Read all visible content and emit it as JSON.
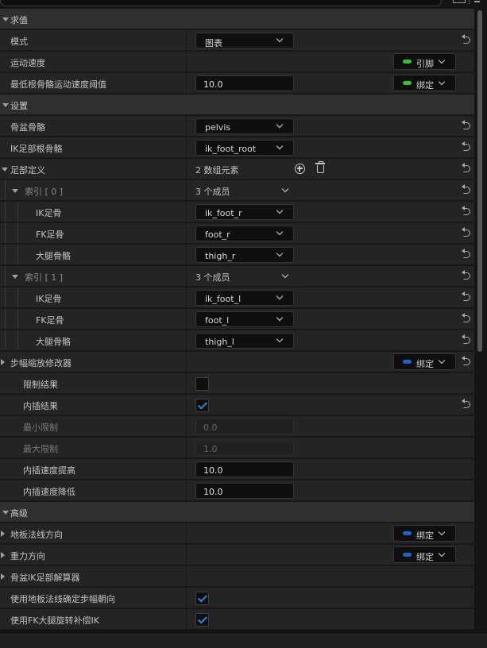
{
  "colors": {
    "link_green": "#35c22a",
    "bind_blue": "#1e64c8",
    "check_blue": "#2b8ae6"
  },
  "rows": [
    {
      "type": "section",
      "label": "求值"
    },
    {
      "type": "combo",
      "label": "模式",
      "value": "图表",
      "reset": true
    },
    {
      "type": "pill",
      "label": "运动速度",
      "pill": "引脚",
      "pill_color": "#35c22a",
      "reset": false
    },
    {
      "type": "num_pill",
      "label": "最低根骨骼运动速度阈值",
      "value": "10.0",
      "pill": "绑定",
      "pill_color": "#35c22a",
      "reset": false
    },
    {
      "type": "section",
      "label": "设置"
    },
    {
      "type": "combo",
      "label": "骨盆骨骼",
      "value": "pelvis",
      "reset": true
    },
    {
      "type": "combo",
      "label": "IK足部根骨骼",
      "value": "ik_foot_root",
      "reset": true
    },
    {
      "type": "array",
      "label": "足部定义",
      "count": "2 数组元素",
      "reset": true
    },
    {
      "type": "index",
      "label": "索引 [ 0 ]",
      "members": "3 个成员",
      "reset": true
    },
    {
      "type": "combo_sub",
      "label": "IK足骨",
      "value": "ik_foot_r",
      "reset": true
    },
    {
      "type": "combo_sub",
      "label": "FK足骨",
      "value": "foot_r",
      "reset": true
    },
    {
      "type": "combo_sub",
      "label": "大腿骨骼",
      "value": "thigh_r",
      "reset": true
    },
    {
      "type": "index",
      "label": "索引 [ 1 ]",
      "members": "3 个成员",
      "reset": true
    },
    {
      "type": "combo_sub",
      "label": "IK足骨",
      "value": "ik_foot_l",
      "reset": true
    },
    {
      "type": "combo_sub",
      "label": "FK足骨",
      "value": "foot_l",
      "reset": true
    },
    {
      "type": "combo_sub",
      "label": "大腿骨骼",
      "value": "thigh_l",
      "reset": true
    },
    {
      "type": "group_pill",
      "label": "步幅缩放修改器",
      "pill": "绑定",
      "pill_color": "#1e64c8",
      "reset": true
    },
    {
      "type": "check",
      "label": "限制结果",
      "checked": false,
      "reset": false
    },
    {
      "type": "check",
      "label": "内插结果",
      "checked": true,
      "reset": true
    },
    {
      "type": "num_dis",
      "label": "最小限制",
      "value": "0.0"
    },
    {
      "type": "num_dis",
      "label": "最大限制",
      "value": "1.0"
    },
    {
      "type": "num",
      "label": "内插速度提高",
      "value": "10.0"
    },
    {
      "type": "num",
      "label": "内插速度降低",
      "value": "10.0"
    },
    {
      "type": "section",
      "label": "高级"
    },
    {
      "type": "group_pill",
      "label": "地板法线方向",
      "pill": "绑定",
      "pill_color": "#1e64c8",
      "reset": false
    },
    {
      "type": "group_pill",
      "label": "重力方向",
      "pill": "绑定",
      "pill_color": "#1e64c8",
      "reset": false
    },
    {
      "type": "group",
      "label": "骨盆IK足部解算器"
    },
    {
      "type": "check",
      "label": "使用地板法线确定步幅朝向",
      "checked": true,
      "reset": false,
      "top": true
    },
    {
      "type": "check",
      "label": "使用FK大腿旋转补偿IK",
      "checked": true,
      "reset": false,
      "top": true
    }
  ]
}
